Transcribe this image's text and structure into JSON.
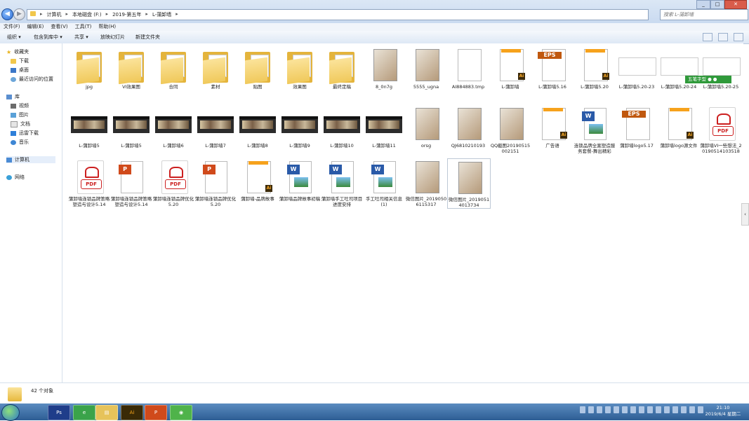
{
  "address": {
    "crumbs": [
      "计算机",
      "本地磁盘 (F:)",
      "2019-第五年",
      "L-蒲卸墙"
    ]
  },
  "search": {
    "placeholder": "搜索 L-蒲卸墙"
  },
  "menu": [
    "文件(F)",
    "编辑(E)",
    "查看(V)",
    "工具(T)",
    "帮助(H)"
  ],
  "toolbar": {
    "organize": "组织 ▾",
    "include": "包含到库中 ▾",
    "share": "共享 ▾",
    "slideshow": "放映幻灯片",
    "newfolder": "新建文件夹"
  },
  "sidebar": {
    "favorites": "收藏夹",
    "downloads": "下载",
    "desktop": "桌面",
    "recent": "最近访问的位置",
    "library": "库",
    "videos": "视频",
    "pictures": "图片",
    "documents": "文档",
    "thunder": "迅雷下载",
    "music": "音乐",
    "computer": "计算机",
    "network": "网络"
  },
  "files": [
    {
      "name": "jpg",
      "kind": "folder"
    },
    {
      "name": "VI效果图",
      "kind": "folder"
    },
    {
      "name": "合同",
      "kind": "folder"
    },
    {
      "name": "素材",
      "kind": "folder"
    },
    {
      "name": "贴图",
      "kind": "folder"
    },
    {
      "name": "效果图",
      "kind": "folder"
    },
    {
      "name": "最终定稿",
      "kind": "folder"
    },
    {
      "name": "8_0n7g",
      "kind": "image"
    },
    {
      "name": "5555_ugna",
      "kind": "image"
    },
    {
      "name": "AI884883.tmp",
      "kind": "blank"
    },
    {
      "name": "L-蒲卸墙",
      "kind": "ai"
    },
    {
      "name": "L-蒲卸墙5.16",
      "kind": "eps"
    },
    {
      "name": "L-蒲卸墙5.20",
      "kind": "ai"
    },
    {
      "name": "L-蒲卸墙5.20-23",
      "kind": "doc"
    },
    {
      "name": "L-蒲卸墙5.20-24",
      "kind": "doc"
    },
    {
      "name": "L-蒲卸墙5.20-25",
      "kind": "doc"
    },
    {
      "name": "L-蒲卸墙5",
      "kind": "wide"
    },
    {
      "name": "L-蒲卸墙5",
      "kind": "wide"
    },
    {
      "name": "L-蒲卸墙6",
      "kind": "wide"
    },
    {
      "name": "L-蒲卸墙7",
      "kind": "wide"
    },
    {
      "name": "L-蒲卸墙8",
      "kind": "wide"
    },
    {
      "name": "L-蒲卸墙9",
      "kind": "wide"
    },
    {
      "name": "L-蒲卸墙10",
      "kind": "wide"
    },
    {
      "name": "L-蒲卸墙11",
      "kind": "wide"
    },
    {
      "name": "orsg",
      "kind": "image"
    },
    {
      "name": "QJ6810210193",
      "kind": "image"
    },
    {
      "name": "QQ截图20190515002151",
      "kind": "image"
    },
    {
      "name": "广告语",
      "kind": "ai"
    },
    {
      "name": "连锁品牌全案塑造服务套餐-舞出精彩",
      "kind": "word"
    },
    {
      "name": "蒲卸墙logo5.17",
      "kind": "eps"
    },
    {
      "name": "蒲卸墙logo源文件",
      "kind": "ai"
    },
    {
      "name": "蒲卸墙VI一些想法_20190514103518",
      "kind": "pdf"
    },
    {
      "name": "蒲卸墙连锁品牌策略塑造与设计5.14",
      "kind": "pdf"
    },
    {
      "name": "蒲卸墙连锁品牌策略塑造与设计5.14",
      "kind": "ppt"
    },
    {
      "name": "蒲卸墙连锁品牌优化5.20",
      "kind": "pdf"
    },
    {
      "name": "蒲卸墙连锁品牌优化5.20",
      "kind": "ppt"
    },
    {
      "name": "蒲卸墙-品牌故事",
      "kind": "ai"
    },
    {
      "name": "蒲卸墙品牌故事初稿",
      "kind": "word"
    },
    {
      "name": "蒲卸墙手工吐司项目进度安排",
      "kind": "word"
    },
    {
      "name": "手工吐司相关信息(1)",
      "kind": "word"
    },
    {
      "name": "微信图片_20190506115317",
      "kind": "image"
    },
    {
      "name": "微信图片_20190514013734",
      "kind": "image"
    }
  ],
  "status": {
    "count": "42 个对象"
  },
  "overlay": {
    "badge": "五笔字型"
  },
  "clock": {
    "time": "21:10",
    "date": "2019/6/4 星期二"
  }
}
